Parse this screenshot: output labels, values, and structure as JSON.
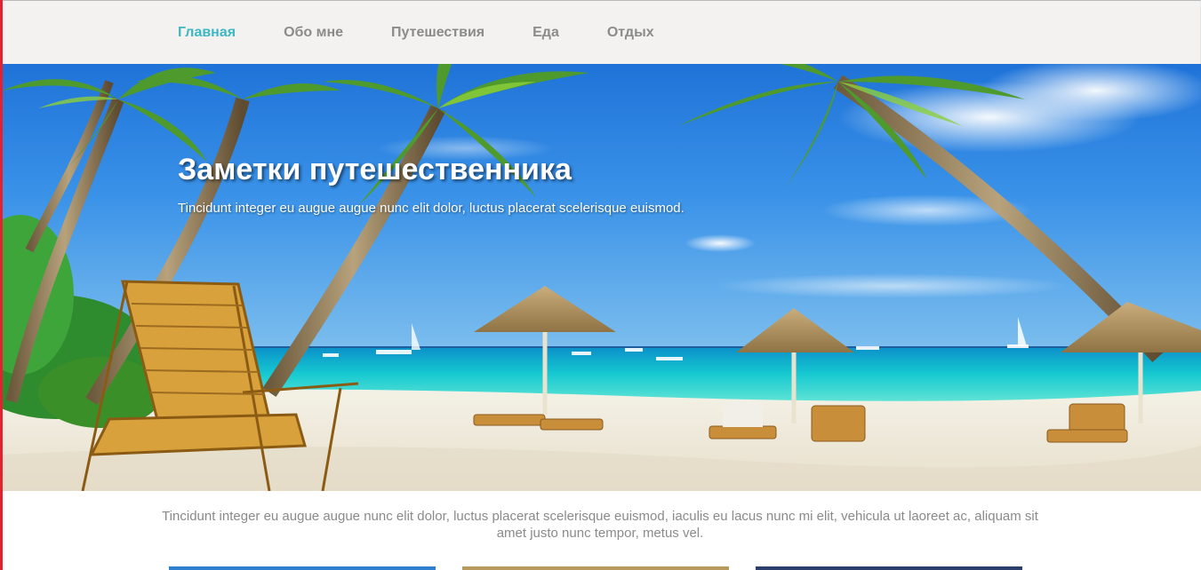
{
  "nav": {
    "items": [
      {
        "label": "Главная",
        "active": true
      },
      {
        "label": "Обо мне",
        "active": false
      },
      {
        "label": "Путешествия",
        "active": false
      },
      {
        "label": "Еда",
        "active": false
      },
      {
        "label": "Отдых",
        "active": false
      }
    ]
  },
  "hero": {
    "title": "Заметки путешественника",
    "subtitle": "Tincidunt integer eu augue augue nunc elit dolor, luctus placerat scelerisque euismod."
  },
  "intro": {
    "text": "Tincidunt integer eu augue augue nunc elit dolor, luctus placerat scelerisque euismod, iaculis eu lacus nunc mi elit, vehicula ut laoreet ac, aliquam sit amet justo nunc tempor, metus vel."
  },
  "colors": {
    "accent": "#3cb7c3",
    "nav_text": "#8b8b8b",
    "nav_background": "#f3f2f0",
    "body_text": "#8a8a8a",
    "left_edge": "#e2232f"
  },
  "cards": [
    {
      "color": "#2f7fd0"
    },
    {
      "color": "#b79a5c"
    },
    {
      "color": "#2c3e6b"
    }
  ]
}
